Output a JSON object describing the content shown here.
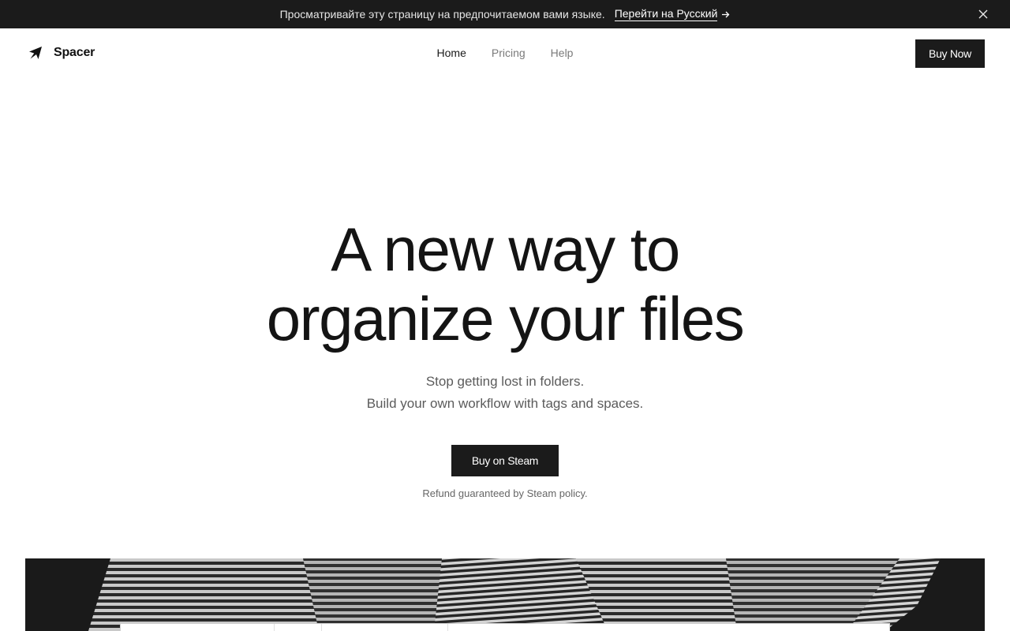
{
  "banner": {
    "message": "Просматривайте эту страницу на предпочитаемом вами языке.",
    "switch_label": "Перейти на Русский",
    "arrow_icon": "arrow-right-icon",
    "close_icon": "close-icon"
  },
  "brand": {
    "logo_icon": "paper-plane-icon",
    "name": "Spacer"
  },
  "nav": {
    "items": [
      {
        "label": "Home",
        "active": true
      },
      {
        "label": "Pricing",
        "active": false
      },
      {
        "label": "Help",
        "active": false
      }
    ],
    "buy_now_label": "Buy Now"
  },
  "hero": {
    "title_line1": "A new way to",
    "title_line2": "organize your files",
    "subtitle_line1": "Stop getting lost in folders.",
    "subtitle_line2": "Build your own workflow with tags and spaces.",
    "cta_label": "Buy on Steam",
    "note": "Refund guaranteed by Steam policy."
  },
  "colors": {
    "dark": "#1b1b1b",
    "text": "#141414",
    "muted": "#7a7a7a",
    "background": "#ffffff"
  }
}
